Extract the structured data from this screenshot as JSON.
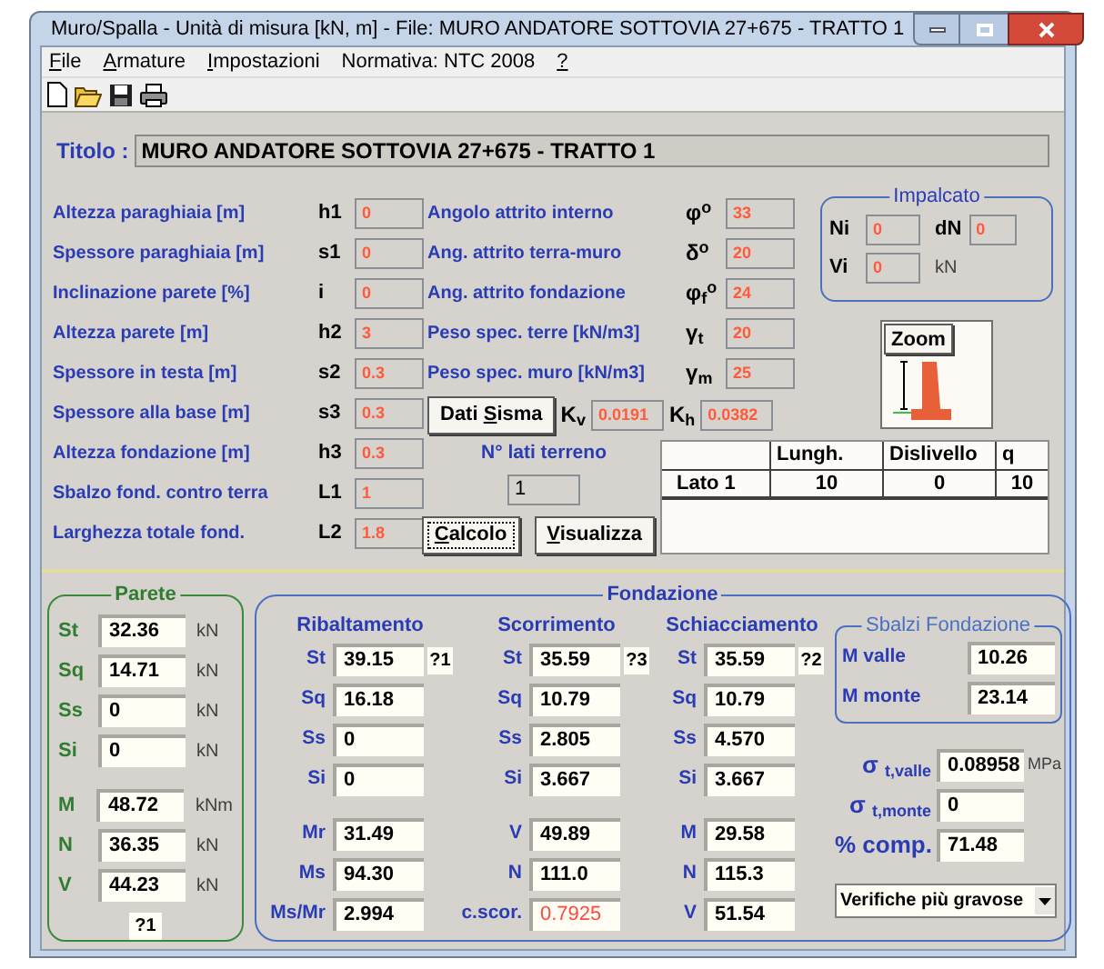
{
  "window": {
    "title": "Muro/Spalla - Unità di misura [kN, m] - File: MURO ANDATORE SOTTOVIA 27+675 - TRATTO 1"
  },
  "menu": [
    {
      "parts": [
        {
          "text": "F",
          "underline": true
        },
        {
          "text": "ile",
          "underline": false
        }
      ]
    },
    {
      "parts": [
        {
          "text": "A",
          "underline": true
        },
        {
          "text": "rmature",
          "underline": false
        }
      ]
    },
    {
      "parts": [
        {
          "text": "I",
          "underline": true
        },
        {
          "text": "mpostazioni",
          "underline": false
        }
      ]
    },
    {
      "parts": [
        {
          "text": "Normativa: NTC 2008",
          "underline": false
        }
      ]
    },
    {
      "parts": [
        {
          "text": "?",
          "underline": true
        }
      ]
    }
  ],
  "titolo": {
    "label": "Titolo :",
    "value": "MURO ANDATORE SOTTOVIA 27+675 - TRATTO 1"
  },
  "params_left": [
    {
      "label": "Altezza paraghiaia [m]",
      "symbol": "h1",
      "value": "0"
    },
    {
      "label": "Spessore paraghiaia [m]",
      "symbol": "s1",
      "value": "0"
    },
    {
      "label": "Inclinazione parete [%]",
      "symbol": "i",
      "value": "0"
    },
    {
      "label": "Altezza parete [m]",
      "symbol": "h2",
      "value": "3"
    },
    {
      "label": "Spessore in testa [m]",
      "symbol": "s2",
      "value": "0.3"
    },
    {
      "label": "Spessore alla base [m]",
      "symbol": "s3",
      "value": "0.3"
    },
    {
      "label": "Altezza fondazione [m]",
      "symbol": "h3",
      "value": "0.3"
    },
    {
      "label": "Sbalzo fond. contro terra",
      "symbol": "L1",
      "value": "1"
    },
    {
      "label": "Larghezza totale fond.",
      "symbol": "L2",
      "value": "1.8"
    }
  ],
  "params_mid": [
    {
      "label": "Angolo attrito interno",
      "symbol": "φ$^{o}$",
      "value": "33"
    },
    {
      "label": "Ang. attrito terra-muro",
      "symbol": "δ$^{o}$",
      "value": "20"
    },
    {
      "label": "Ang. attrito fondazione",
      "symbol": "φ$_{f}$$^{o}$",
      "value": "24"
    },
    {
      "label": "Peso spec. terre [kN/m3]",
      "symbol": "γ$_{t}$",
      "value": "20"
    },
    {
      "label": "Peso spec. muro [kN/m3]",
      "symbol": "γ$_{m}$",
      "value": "25"
    }
  ],
  "sisma": {
    "button": [
      {
        "text": "Dati ",
        "underline": false
      },
      {
        "text": "S",
        "underline": true
      },
      {
        "text": "isma",
        "underline": false
      }
    ],
    "kv_symbol": "K$_{v}$",
    "kv": "0.0191",
    "kh_symbol": "K$_{h}$",
    "kh": "0.0382"
  },
  "lati": {
    "label": "N° lati terreno",
    "value": "1"
  },
  "actions": [
    {
      "focused": true,
      "parts": [
        {
          "text": "C",
          "underline": true
        },
        {
          "text": "alcolo",
          "underline": false
        }
      ]
    },
    {
      "focused": false,
      "parts": [
        {
          "text": "V",
          "underline": true
        },
        {
          "text": "isualizza",
          "underline": false
        }
      ]
    }
  ],
  "impalcato": {
    "title": "Impalcato",
    "ni_label": "Ni",
    "ni": "0",
    "dn_label": "dN",
    "dn": "0",
    "vi_label": "Vi",
    "vi": "0",
    "unit": "kN"
  },
  "zoom": {
    "button": "Zoom"
  },
  "lati_table": {
    "columns": [
      "Lungh.",
      "Dislivello",
      "q"
    ],
    "rows": [
      {
        "name": "Lato 1",
        "cells": [
          "10",
          "0",
          "10"
        ]
      }
    ]
  },
  "parete": {
    "title": "Parete",
    "marker": "?1",
    "groups": [
      [
        {
          "label": "St",
          "value": "32.36",
          "unit": "kN"
        },
        {
          "label": "Sq",
          "value": "14.71",
          "unit": "kN"
        },
        {
          "label": "Ss",
          "value": "0",
          "unit": "kN"
        },
        {
          "label": "Si",
          "value": "0",
          "unit": "kN"
        }
      ],
      [
        {
          "label": "M",
          "value": "48.72",
          "unit": "kNm"
        },
        {
          "label": "N",
          "value": "36.35",
          "unit": "kN"
        },
        {
          "label": "V",
          "value": "44.23",
          "unit": "kN"
        }
      ]
    ]
  },
  "fondazione": {
    "title": "Fondazione",
    "columns": [
      {
        "title": "Ribaltamento",
        "marker": "?1",
        "groups": [
          [
            {
              "label": "St",
              "value": "39.15",
              "alert": false
            },
            {
              "label": "Sq",
              "value": "16.18",
              "alert": false
            },
            {
              "label": "Ss",
              "value": "0",
              "alert": false
            },
            {
              "label": "Si",
              "value": "0",
              "alert": false
            }
          ],
          [
            {
              "label": "Mr",
              "value": "31.49",
              "alert": false
            },
            {
              "label": "Ms",
              "value": "94.30",
              "alert": false
            },
            {
              "label": "Ms/Mr",
              "value": "2.994",
              "alert": false
            }
          ]
        ]
      },
      {
        "title": "Scorrimento",
        "marker": "?3",
        "groups": [
          [
            {
              "label": "St",
              "value": "35.59",
              "alert": false
            },
            {
              "label": "Sq",
              "value": "10.79",
              "alert": false
            },
            {
              "label": "Ss",
              "value": "2.805",
              "alert": false
            },
            {
              "label": "Si",
              "value": "3.667",
              "alert": false
            }
          ],
          [
            {
              "label": "V",
              "value": "49.89",
              "alert": false
            },
            {
              "label": "N",
              "value": "111.0",
              "alert": false
            },
            {
              "label": "c.scor.",
              "value": "0.7925",
              "alert": true
            }
          ]
        ]
      },
      {
        "title": "Schiacciamento",
        "marker": "?2",
        "groups": [
          [
            {
              "label": "St",
              "value": "35.59",
              "alert": false
            },
            {
              "label": "Sq",
              "value": "10.79",
              "alert": false
            },
            {
              "label": "Ss",
              "value": "4.570",
              "alert": false
            },
            {
              "label": "Si",
              "value": "3.667",
              "alert": false
            }
          ],
          [
            {
              "label": "M",
              "value": "29.58",
              "alert": false
            },
            {
              "label": "N",
              "value": "115.3",
              "alert": false
            },
            {
              "label": "V",
              "value": "51.54",
              "alert": false
            }
          ]
        ]
      }
    ],
    "sbalzi": {
      "title": "Sbalzi Fondazione",
      "rows": [
        {
          "label": "M valle",
          "value": "10.26"
        },
        {
          "label": "M monte",
          "value": "23.14"
        }
      ]
    },
    "sigma": [
      {
        "label": "σ $_{t,valle}$",
        "value": "0.08958",
        "unit": "MPa"
      },
      {
        "label": "σ $_{t,monte}$",
        "value": "0"
      },
      {
        "label": "% comp.",
        "value": "71.48"
      }
    ],
    "dropdown": "Verifiche più gravose"
  }
}
